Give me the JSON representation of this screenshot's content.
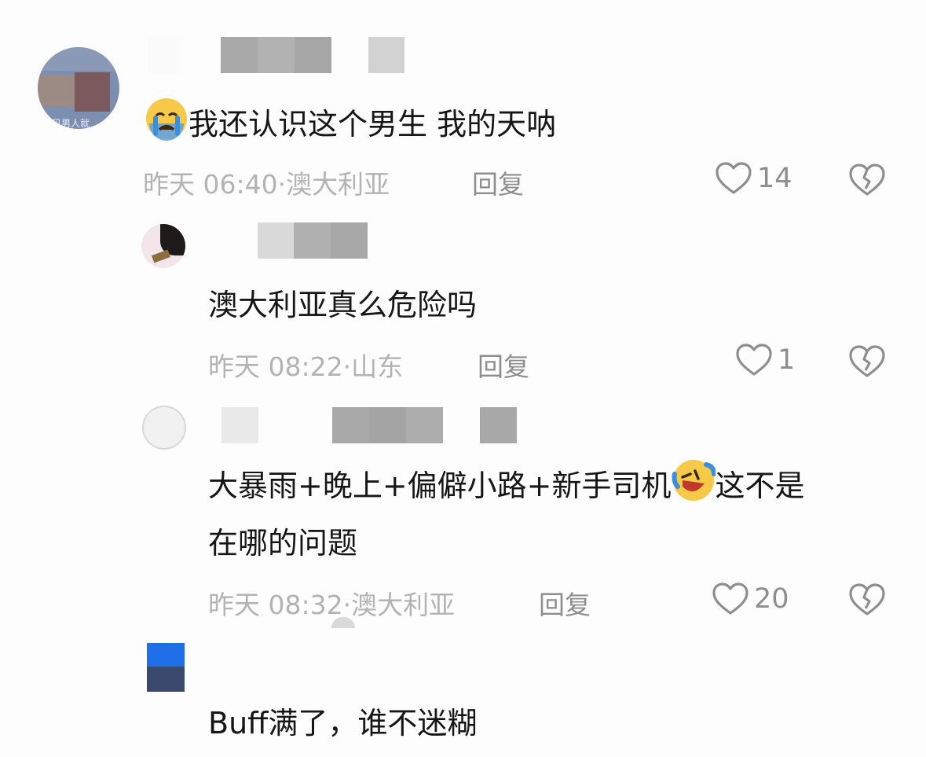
{
  "comments": [
    {
      "text": "我还认识这个男生 我的天呐",
      "emoji": "crying-face",
      "time": "昨天 06:40",
      "location": "澳大利亚",
      "reply_label": "回复",
      "likes": "14",
      "avatar_text": "见男人就"
    },
    {
      "text": "澳大利亚真么危险吗",
      "time": "昨天 08:22",
      "location": "山东",
      "reply_label": "回复",
      "likes": "1"
    },
    {
      "text_line1a": "大暴雨+晚上+偏僻小路+新手司机",
      "text_line1b": "这不是",
      "text_line2": "在哪的问题",
      "emoji": "rolling-laughing-face",
      "time": "昨天 08:32",
      "location": "澳大利亚",
      "reply_label": "回复",
      "likes": "20"
    },
    {
      "text": "Buff满了，谁不迷糊"
    }
  ],
  "separator": "·",
  "colors": {
    "text": "#161616",
    "meta": "#b3b3b3",
    "action": "#8e8e8e"
  }
}
